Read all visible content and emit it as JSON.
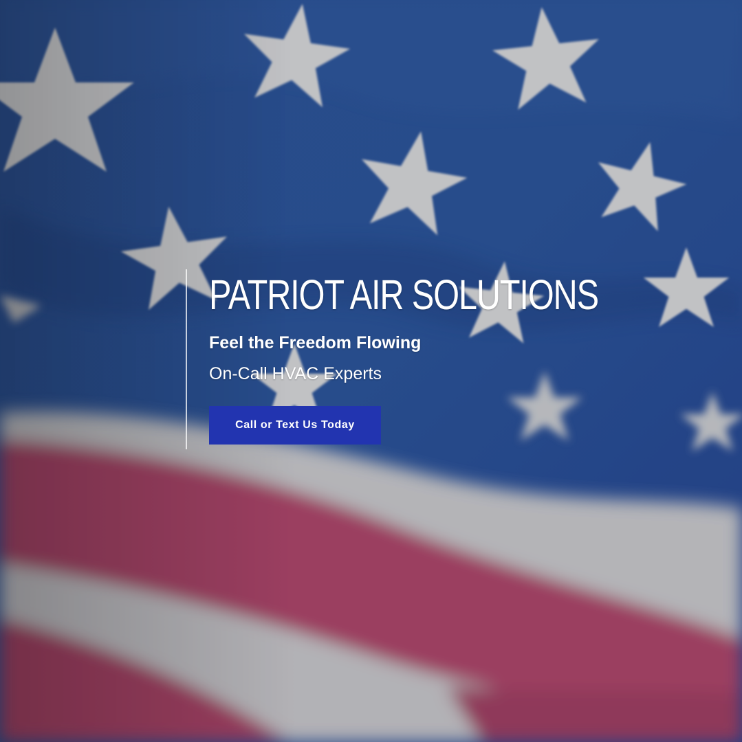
{
  "hero": {
    "title": "PATRIOT AIR SOLUTIONS",
    "tagline": "Feel the Freedom Flowing",
    "subtitle": "On-Call HVAC Experts",
    "cta_label": "Call or Text Us Today",
    "background_image": "american-flag-icon"
  },
  "colors": {
    "flag_blue": "#2d59a6",
    "flag_red": "#b8446f",
    "flag_white": "#d9d9dc",
    "cta_background": "#2234b0",
    "text": "#ffffff"
  }
}
